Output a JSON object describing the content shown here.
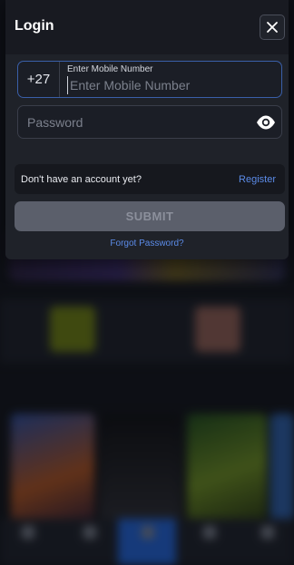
{
  "login": {
    "title": "Login",
    "country_code": "+27",
    "mobile_label": "Enter Mobile Number",
    "mobile_placeholder": "Enter Mobile Number",
    "password_placeholder": "Password",
    "no_account_text": "Don't have an account yet?",
    "register_label": "Register",
    "submit_label": "SUBMIT",
    "forgot_label": "Forgot Password?"
  },
  "colors": {
    "panel_bg": "#1f2229",
    "accent_link": "#5b8be8",
    "submit_disabled": "#5b5f6b",
    "focus_border": "#3a5fa8"
  },
  "icons": {
    "close": "close-icon",
    "password_toggle": "eye-icon"
  }
}
